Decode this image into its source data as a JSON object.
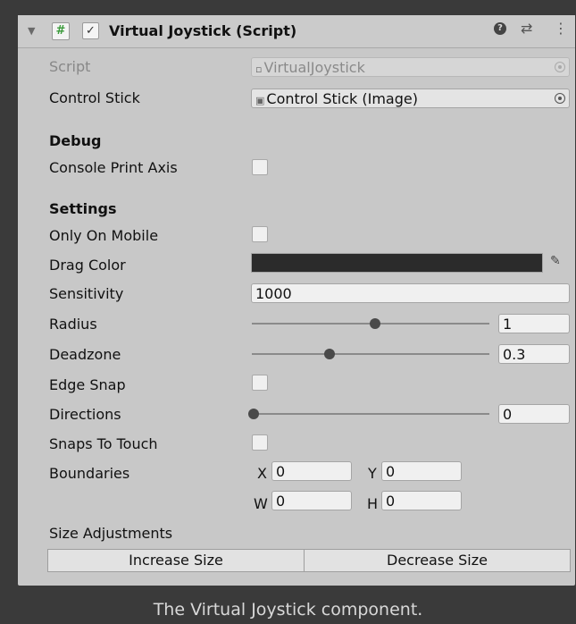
{
  "header": {
    "fold": "▼",
    "hash": "#",
    "check": "✓",
    "title": "Virtual Joystick (Script)",
    "help": "?",
    "presets": "⇄",
    "menu": "⋮"
  },
  "script": {
    "label": "Script",
    "value": "VirtualJoystick"
  },
  "control_stick": {
    "label": "Control Stick",
    "value": "Control Stick (Image)"
  },
  "debug": {
    "heading": "Debug",
    "console_print_axis": "Console Print Axis"
  },
  "settings": {
    "heading": "Settings",
    "only_on_mobile": "Only On Mobile",
    "drag_color": {
      "label": "Drag Color",
      "value": "#2b2b2b"
    },
    "sensitivity": {
      "label": "Sensitivity",
      "value": "1000"
    },
    "radius": {
      "label": "Radius",
      "value": "1",
      "level": 0.51
    },
    "deadzone": {
      "label": "Deadzone",
      "value": "0.3",
      "level": 0.32
    },
    "edge_snap": "Edge Snap",
    "directions": {
      "label": "Directions",
      "value": "0",
      "level": 0
    },
    "snaps_to_touch": "Snaps To Touch",
    "boundaries": {
      "label": "Boundaries",
      "x_label": "X",
      "x": "0",
      "y_label": "Y",
      "y": "0",
      "w_label": "W",
      "w": "0",
      "h_label": "H",
      "h": "0"
    }
  },
  "size_adjustments": {
    "label": "Size Adjustments",
    "increase": "Increase Size",
    "decrease": "Decrease Size"
  },
  "caption": "The Virtual Joystick component."
}
